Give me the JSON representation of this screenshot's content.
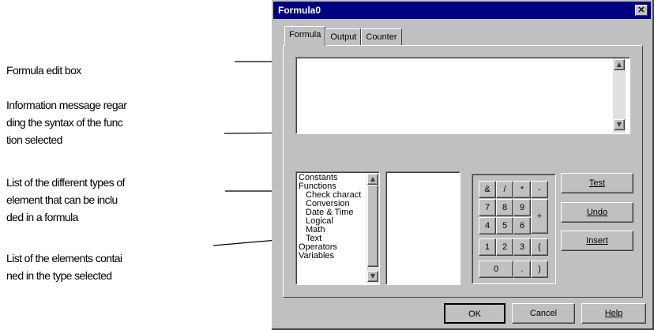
{
  "annotations": {
    "edit_box": "Formula edit box",
    "info_message": [
      "Information message regar",
      "ding the syntax of the func",
      "tion selected"
    ],
    "type_list": [
      "List of the different types of",
      "element that can be inclu",
      "ded in a formula"
    ],
    "element_list": [
      "List of the elements contai",
      "ned in the type selected"
    ]
  },
  "window": {
    "title": "Formula0",
    "close_glyph": "✕"
  },
  "tabs": [
    {
      "label": "Formula",
      "active": true
    },
    {
      "label": "Output",
      "active": false
    },
    {
      "label": "Counter",
      "active": false
    }
  ],
  "formula": {
    "value": ""
  },
  "type_list": [
    {
      "label": "Constants",
      "level": 0
    },
    {
      "label": "Functions",
      "level": 0
    },
    {
      "label": "Check charact",
      "level": 1
    },
    {
      "label": "Conversion",
      "level": 1
    },
    {
      "label": "Date & Time",
      "level": 1
    },
    {
      "label": "Logical",
      "level": 1
    },
    {
      "label": "Math",
      "level": 1
    },
    {
      "label": "Text",
      "level": 1
    },
    {
      "label": "Operators",
      "level": 0
    },
    {
      "label": "Variables",
      "level": 0
    }
  ],
  "keypad": {
    "row1": [
      "&",
      "/",
      "*",
      "-"
    ],
    "row2": [
      "7",
      "8",
      "9"
    ],
    "row3": [
      "4",
      "5",
      "6"
    ],
    "row4": [
      "1",
      "2",
      "3",
      "("
    ],
    "row5": [
      "0",
      ".",
      ")"
    ],
    "plus": "+"
  },
  "side_buttons": {
    "test": "Test",
    "undo": "Undo",
    "insert": "Insert"
  },
  "footer": {
    "ok": "OK",
    "cancel": "Cancel",
    "help": "Help"
  }
}
